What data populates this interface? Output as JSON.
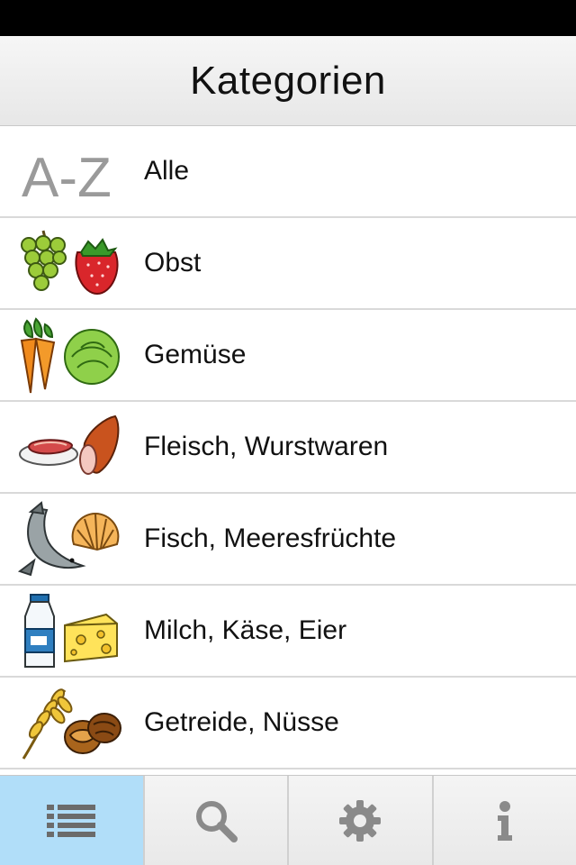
{
  "nav": {
    "title": "Kategorien"
  },
  "categories": [
    {
      "label": "Alle",
      "icon": "a-z-icon"
    },
    {
      "label": "Obst",
      "icon": "fruit-icon"
    },
    {
      "label": "Gemüse",
      "icon": "vegetables-icon"
    },
    {
      "label": "Fleisch, Wurstwaren",
      "icon": "meat-sausage-icon"
    },
    {
      "label": "Fisch, Meeresfrüchte",
      "icon": "fish-shell-icon"
    },
    {
      "label": "Milch, Käse, Eier",
      "icon": "milk-cheese-icon"
    },
    {
      "label": "Getreide, Nüsse",
      "icon": "grain-nuts-icon"
    }
  ],
  "icon_glyph": {
    "a_z": "A-Z"
  },
  "tabs": [
    {
      "name": "list",
      "icon": "list-icon",
      "active": true
    },
    {
      "name": "search",
      "icon": "search-icon",
      "active": false
    },
    {
      "name": "settings",
      "icon": "gear-icon",
      "active": false
    },
    {
      "name": "info",
      "icon": "info-icon",
      "active": false
    }
  ],
  "colors": {
    "status_bar": "#000000",
    "active_tab": "#b1def9",
    "tab_icon": "#8a8a8a",
    "active_tab_icon": "#6b6b6b",
    "separator": "#d9d9d9"
  }
}
